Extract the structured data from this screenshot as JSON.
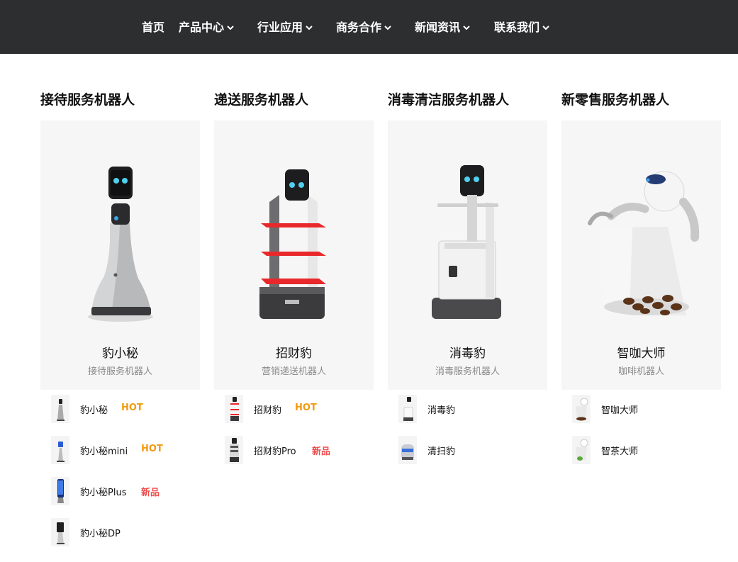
{
  "nav": {
    "items": [
      {
        "label": "首页",
        "has_dropdown": false
      },
      {
        "label": "产品中心",
        "has_dropdown": true
      },
      {
        "label": "行业应用",
        "has_dropdown": true
      },
      {
        "label": "商务合作",
        "has_dropdown": true
      },
      {
        "label": "新闻资讯",
        "has_dropdown": true
      },
      {
        "label": "联系我们",
        "has_dropdown": true
      }
    ]
  },
  "categories": [
    {
      "title": "接待服务机器人",
      "featured": {
        "name": "豹小秘",
        "subtitle": "接待服务机器人",
        "image": "reception-robot-image"
      },
      "items": [
        {
          "label": "豹小秘",
          "badge": "HOT",
          "thumb": "reception-robot-thumb"
        },
        {
          "label": "豹小秘mini",
          "badge": "HOT",
          "thumb": "mini-robot-thumb"
        },
        {
          "label": "豹小秘Plus",
          "badge": "新品",
          "thumb": "plus-robot-thumb"
        },
        {
          "label": "豹小秘DP",
          "badge": "",
          "thumb": "dp-robot-thumb"
        }
      ]
    },
    {
      "title": "递送服务机器人",
      "featured": {
        "name": "招财豹",
        "subtitle": "营销递送机器人",
        "image": "delivery-robot-image"
      },
      "items": [
        {
          "label": "招财豹",
          "badge": "HOT",
          "thumb": "delivery-robot-thumb"
        },
        {
          "label": "招财豹Pro",
          "badge": "新品",
          "thumb": "delivery-pro-robot-thumb"
        }
      ]
    },
    {
      "title": "消毒清洁服务机器人",
      "featured": {
        "name": "消毒豹",
        "subtitle": "消毒服务机器人",
        "image": "disinfection-robot-image"
      },
      "items": [
        {
          "label": "消毒豹",
          "badge": "",
          "thumb": "disinfection-robot-thumb"
        },
        {
          "label": "清扫豹",
          "badge": "",
          "thumb": "cleaning-robot-thumb"
        }
      ]
    },
    {
      "title": "新零售服务机器人",
      "featured": {
        "name": "智咖大师",
        "subtitle": "咖啡机器人",
        "image": "coffee-robot-image"
      },
      "items": [
        {
          "label": "智咖大师",
          "badge": "",
          "thumb": "coffee-robot-thumb"
        },
        {
          "label": "智茶大师",
          "badge": "",
          "thumb": "tea-robot-thumb"
        }
      ]
    }
  ],
  "colors": {
    "topbar_bg": "#2d2e30",
    "hot": "#f29a12",
    "new": "#ee4d4d",
    "card_bg": "#f6f6f6",
    "tray_red": "#e8282b"
  }
}
